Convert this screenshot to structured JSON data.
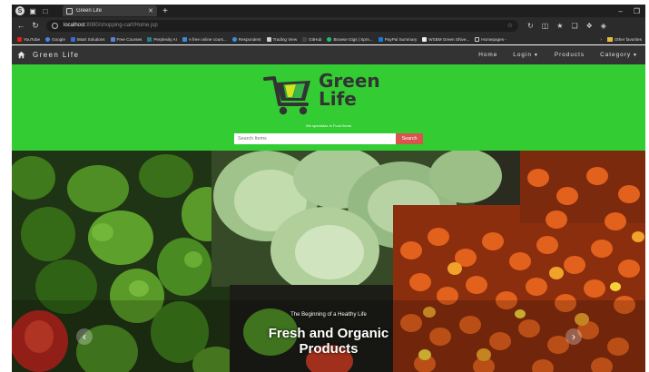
{
  "browser": {
    "tab_title": "Green Life",
    "url_host": "localhost",
    "url_path": ":8080/shopping-cart/Home.jsp",
    "bookmarks": [
      "YouTube",
      "Google",
      "IMart Solutions",
      "Free Courses",
      "Perplexity AI",
      "A free online cours...",
      "Respondent",
      "Trading View",
      "GitHub",
      "Browse Gigs | Sprn...",
      "PayPal Summary",
      "WSBM Green Shive...",
      "Homepages -"
    ],
    "other_favorites": "Other favorites"
  },
  "nav": {
    "brand": "Green Life",
    "home": "Home",
    "login": "Login",
    "products": "Products",
    "category": "Category"
  },
  "header": {
    "logo_line1": "Green",
    "logo_line2": "Life",
    "tagline": "We specialize in Food Items",
    "search_placeholder": "Search Items",
    "search_button": "Search"
  },
  "hero": {
    "subtitle": "The Beginning of a Healthy Life",
    "title": "Fresh and Organic Products",
    "prev_icon": "chevron-left-icon",
    "next_icon": "chevron-right-icon"
  },
  "colors": {
    "header_green": "#33cc33",
    "navbar": "#333333",
    "search_button": "#d9534f"
  }
}
